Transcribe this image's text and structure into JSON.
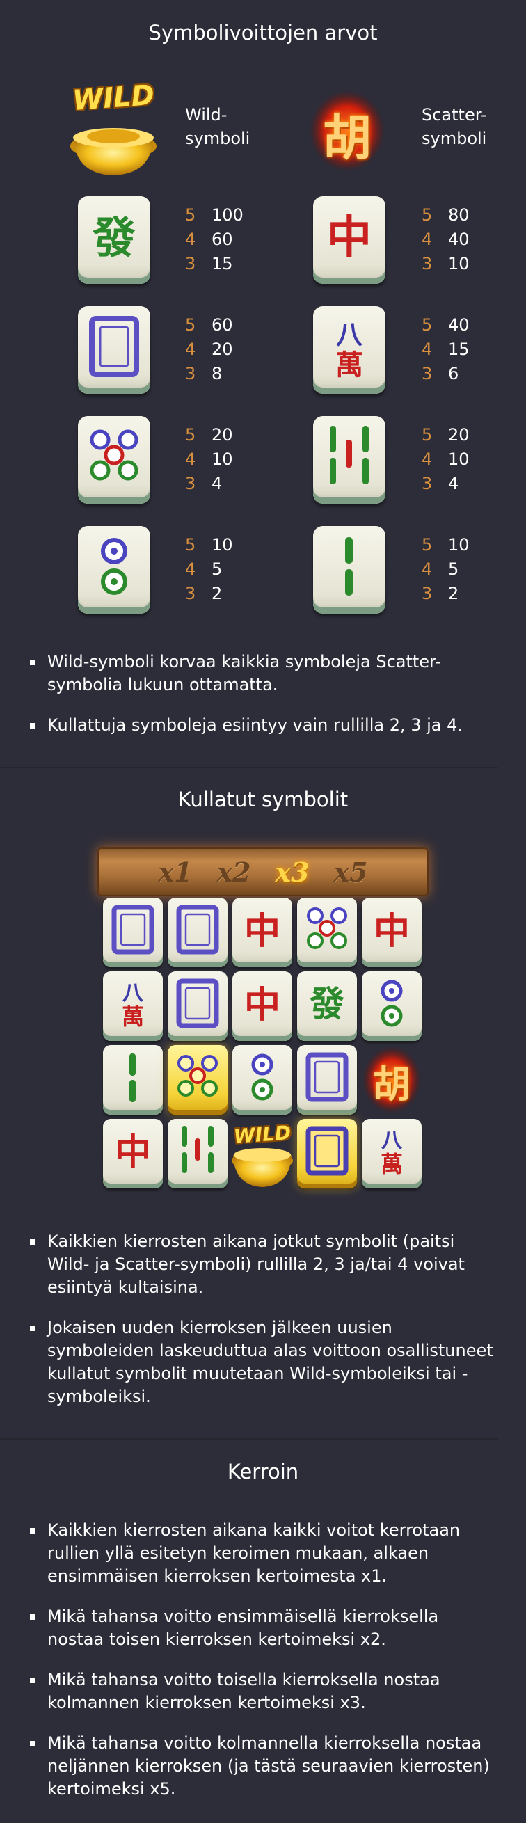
{
  "sections": {
    "paytable_title": "Symbolivoittojen arvot",
    "golden_title": "Kullatut symbolit",
    "multiplier_title": "Kerroin"
  },
  "wild": {
    "logo": "WILD",
    "label_line1": "Wild-",
    "label_line2": "symboli"
  },
  "scatter": {
    "glyph": "胡",
    "label_line1": "Scatter-",
    "label_line2": "symboli"
  },
  "paytable": [
    {
      "symbol": "green-fa-icon",
      "pays": [
        [
          "5",
          "100"
        ],
        [
          "4",
          "60"
        ],
        [
          "3",
          "15"
        ]
      ]
    },
    {
      "symbol": "red-zhong-icon",
      "pays": [
        [
          "5",
          "80"
        ],
        [
          "4",
          "40"
        ],
        [
          "3",
          "10"
        ]
      ]
    },
    {
      "symbol": "white-dragon-icon",
      "pays": [
        [
          "5",
          "60"
        ],
        [
          "4",
          "20"
        ],
        [
          "3",
          "8"
        ]
      ]
    },
    {
      "symbol": "eight-wan-icon",
      "pays": [
        [
          "5",
          "40"
        ],
        [
          "4",
          "15"
        ],
        [
          "3",
          "6"
        ]
      ]
    },
    {
      "symbol": "five-dots-icon",
      "pays": [
        [
          "5",
          "20"
        ],
        [
          "4",
          "10"
        ],
        [
          "3",
          "4"
        ]
      ]
    },
    {
      "symbol": "five-bamboo-icon",
      "pays": [
        [
          "5",
          "20"
        ],
        [
          "4",
          "10"
        ],
        [
          "3",
          "4"
        ]
      ]
    },
    {
      "symbol": "two-dots-icon",
      "pays": [
        [
          "5",
          "10"
        ],
        [
          "4",
          "5"
        ],
        [
          "3",
          "2"
        ]
      ]
    },
    {
      "symbol": "two-bamboo-icon",
      "pays": [
        [
          "5",
          "10"
        ],
        [
          "4",
          "5"
        ],
        [
          "3",
          "2"
        ]
      ]
    }
  ],
  "glyphs": {
    "fa": "發",
    "zhong": "中",
    "ba": "八",
    "wan": "萬"
  },
  "bullets_wild": [
    "Wild-symboli korvaa kaikkia symboleja Scatter-symbolia lukuun ottamatta.",
    "Kullattuja symboleja esiintyy vain rullilla 2, 3 ja 4."
  ],
  "multipliers": [
    "x1",
    "x2",
    "x3",
    "x5"
  ],
  "active_multiplier": "x3",
  "bullets_golden": [
    "Kaikkien kierrosten aikana jotkut symbolit (paitsi Wild- ja Scatter-symboli) rullilla 2, 3 ja/tai 4 voivat esiintyä kultaisina.",
    "Jokaisen uuden kierroksen jälkeen uusien symboleiden laskeuduttua alas voittoon osallistuneet kullatut symbolit muutetaan Wild-symboleiksi tai -symboleiksi."
  ],
  "bullets_multiplier": [
    "Kaikkien kierrosten aikana kaikki voitot kerrotaan rullien yllä esitetyn keroimen mukaan, alkaen ensimmäisen kierroksen kertoimesta x1.",
    "Mikä tahansa voitto ensimmäisellä kierroksella nostaa toisen kierroksen kertoimeksi x2.",
    "Mikä tahansa voitto toisella kierroksella nostaa kolmannen kierroksen kertoimeksi x3.",
    "Mikä tahansa voitto kolmannella kierroksella nostaa neljännen kierroksen (ja tästä seuraavien kierrosten) kertoimeksi x5."
  ],
  "grid": [
    [
      "white-dragon-icon",
      "white-dragon-icon",
      "red-zhong-icon",
      "five-dots-icon",
      "red-zhong-icon"
    ],
    [
      "eight-wan-icon",
      "white-dragon-icon",
      "red-zhong-icon",
      "green-fa-icon",
      "two-dots-icon"
    ],
    [
      "two-bamboo-icon",
      "golden-five-dots-icon",
      "two-dots-icon",
      "white-dragon-icon",
      "scatter-icon"
    ],
    [
      "red-zhong-icon",
      "five-bamboo-icon",
      "wild-icon",
      "golden-white-dragon-icon",
      "eight-wan-icon"
    ]
  ],
  "colors": {
    "background": "#2d2d39",
    "accent_count": "#d9903e",
    "text": "#ffffff"
  }
}
